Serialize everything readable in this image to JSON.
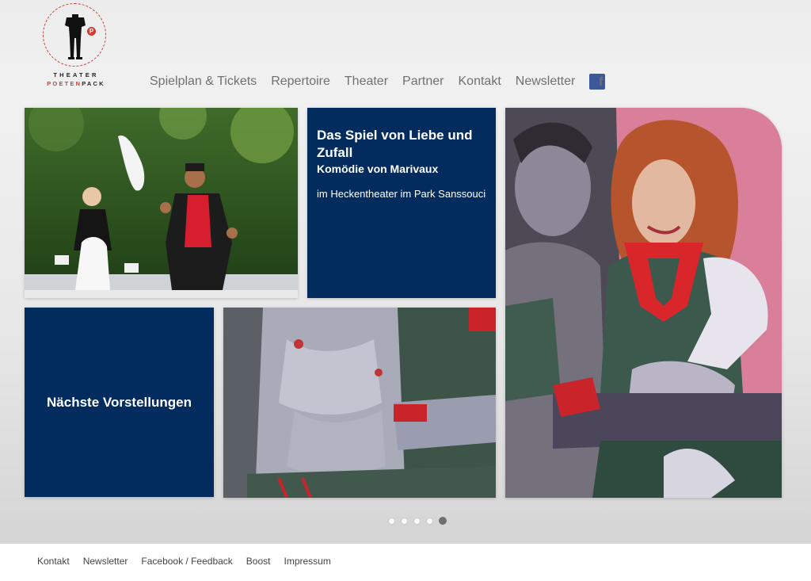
{
  "logo": {
    "line1": "THEATER",
    "line2_a": "POETEN",
    "line2_b": "PACK",
    "badge": "P",
    "accent": "#d43b33"
  },
  "nav": {
    "items": [
      "Spielplan & Tickets",
      "Repertoire",
      "Theater",
      "Partner",
      "Kontakt",
      "Newsletter"
    ],
    "social_icon": "facebook-icon",
    "social_glyph": "f"
  },
  "feature": {
    "title": "Das Spiel von Liebe und Zufall",
    "subtitle": "Komödie von Marivaux",
    "location": "im Heckentheater im Park Sanssouci",
    "bg": "#032c5e"
  },
  "next_shows": {
    "label": "Nächste Vorstellungen"
  },
  "slider": {
    "count": 5,
    "active": 5
  },
  "footer": {
    "links": [
      "Kontakt",
      "Newsletter",
      "Facebook / Feedback",
      "Boost",
      "Impressum"
    ]
  }
}
